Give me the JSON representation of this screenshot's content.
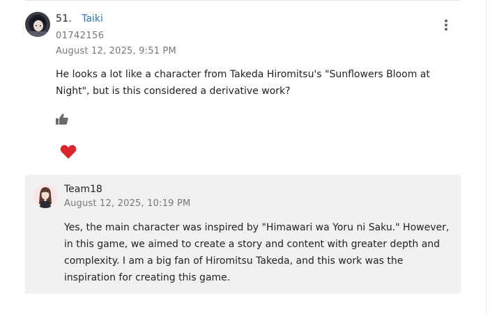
{
  "comment": {
    "number": "51.",
    "author": "Taiki",
    "user_id": "01742156",
    "date": "August 12, 2025, 9:51 PM",
    "body": "He looks a lot like a character from Takeda Hiromitsu's \"Sunflowers Bloom at Night\", but is this considered a derivative work?",
    "like_icon": "thumbs-up-icon",
    "reaction_icon": "heart-icon",
    "menu_icon": "more-vertical-icon"
  },
  "reply": {
    "author": "Team18",
    "date": "August 12, 2025, 10:19 PM",
    "body": "Yes, the main character was inspired by \"Himawari wa Yoru ni Saku.\" However, in this game, we aimed to create a story and content with greater depth and complexity. I am a big fan of Hiromitsu Takeda, and this work was the inspiration for creating this game."
  },
  "colors": {
    "link": "#2f6fb7",
    "heart": "#d9262c",
    "reply_background": "#f2f0f1",
    "muted_text": "#777777"
  }
}
